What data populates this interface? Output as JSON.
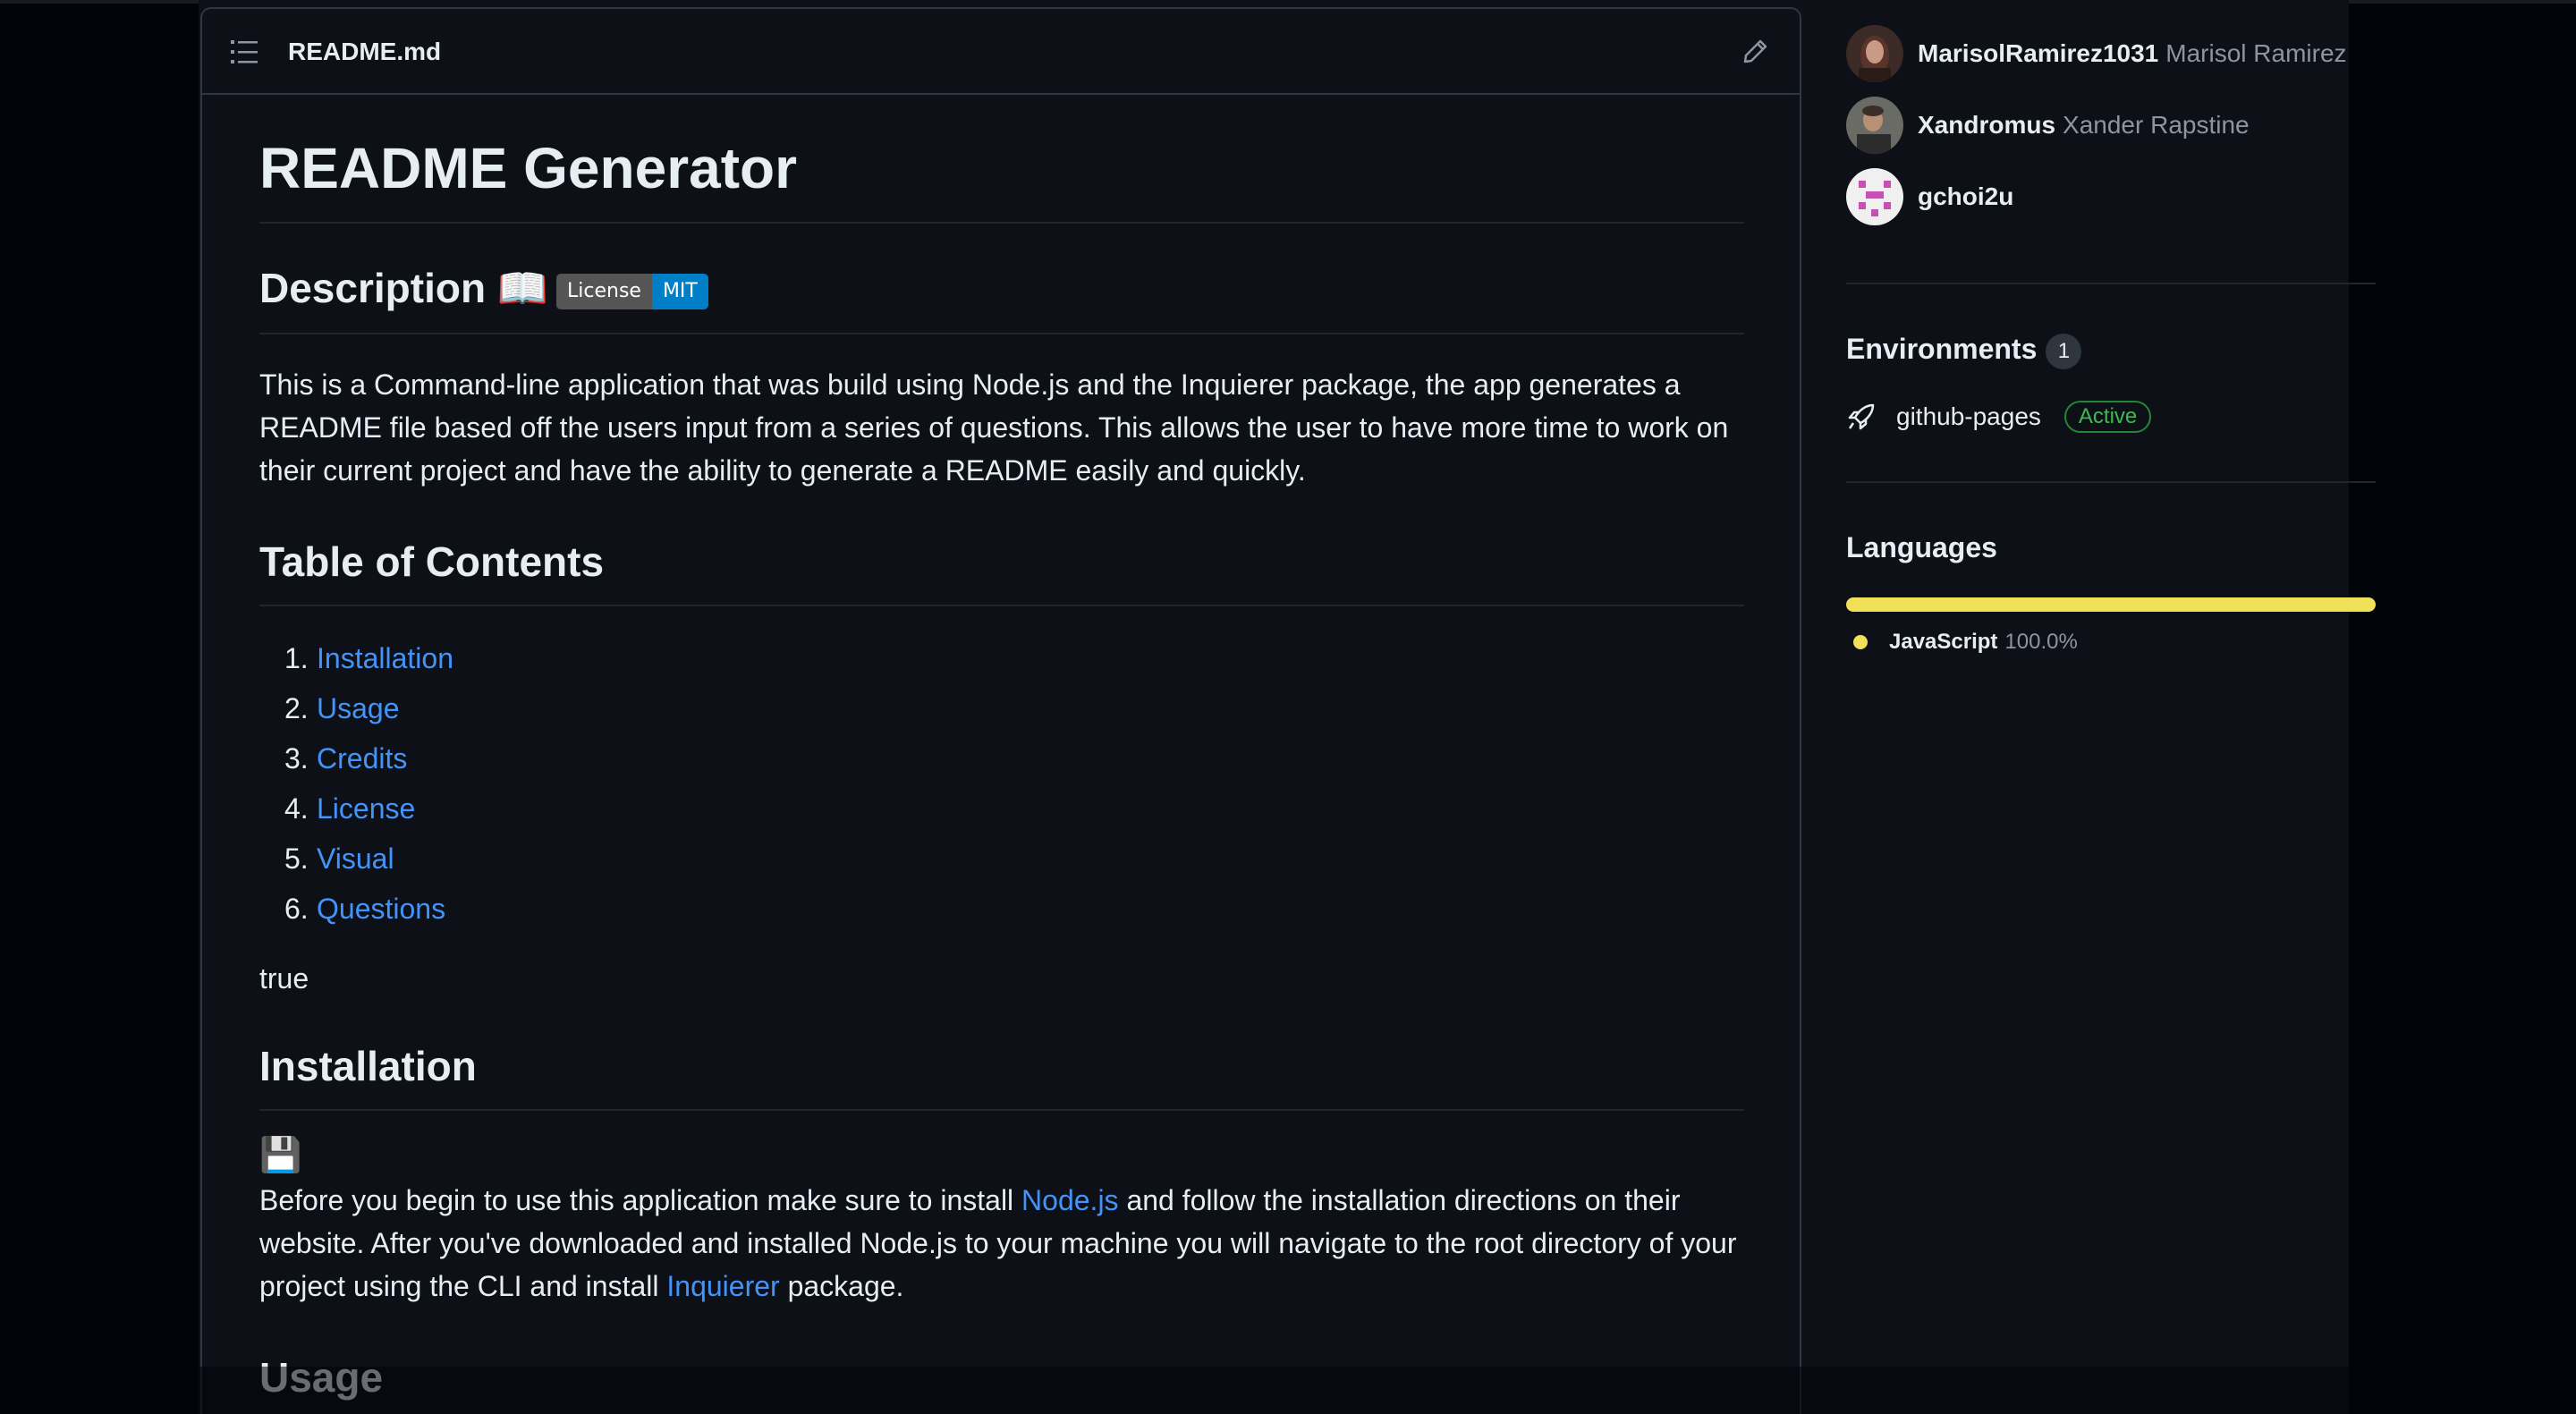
{
  "file": {
    "name": "README.md"
  },
  "readme": {
    "title": "README Generator",
    "description_heading": "Description 📖",
    "badge": {
      "label": "License",
      "value": "MIT"
    },
    "description_text": "This is a Command-line application that was build using Node.js and the Inquierer package, the app generates a README file based off the users input from a series of questions. This allows the user to have more time to work on their current project and have the ability to generate a README easily and quickly.",
    "toc_heading": "Table of Contents",
    "toc": [
      {
        "num": "1.",
        "label": "Installation"
      },
      {
        "num": "2.",
        "label": "Usage"
      },
      {
        "num": "3.",
        "label": "Credits"
      },
      {
        "num": "4.",
        "label": "License"
      },
      {
        "num": "5.",
        "label": "Visual"
      },
      {
        "num": "6.",
        "label": "Questions"
      }
    ],
    "stray_text": "true",
    "installation_heading": "Installation",
    "installation_emoji": "💾",
    "installation_text_1": "Before you begin to use this application make sure to install ",
    "installation_link_node": "Node.js",
    "installation_text_2": " and follow the installation directions on their website. After you've downloaded and installed Node.js to your machine you will navigate to the root directory of your project using the CLI and install ",
    "installation_link_inquirer": "Inquierer",
    "installation_text_3": " package.",
    "usage_heading": "Usage"
  },
  "sidebar": {
    "contributors": [
      {
        "login": "MarisolRamirez1031",
        "name": "Marisol Ramirez"
      },
      {
        "login": "Xandromus",
        "name": "Xander Rapstine"
      },
      {
        "login": "gchoi2u",
        "name": ""
      }
    ],
    "environments": {
      "heading": "Environments",
      "count": "1",
      "items": [
        {
          "name": "github-pages",
          "status": "Active"
        }
      ]
    },
    "languages": {
      "heading": "Languages",
      "items": [
        {
          "name": "JavaScript",
          "percent": "100.0%",
          "color": "#f1e05a",
          "fraction": 1.0
        }
      ]
    }
  },
  "colors": {
    "link": "#4493f8",
    "background": "#0d1117",
    "border": "#30363d",
    "active_green": "#3fb950"
  }
}
